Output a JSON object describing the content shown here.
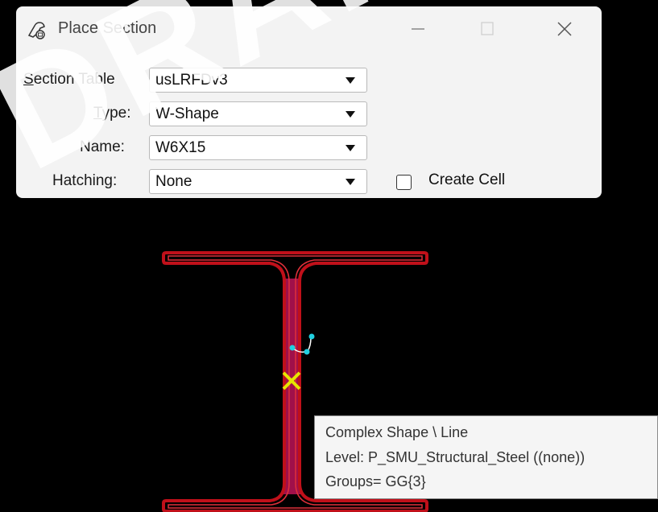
{
  "dialog": {
    "title": "Place Section",
    "labels": {
      "section_table_first": "S",
      "section_table_rest": "ection Table",
      "type_first": "T",
      "type_rest": "ype:",
      "name": "Name:",
      "hatching": "Hatching:"
    },
    "section_table": "usLRFDv3",
    "type": "W-Shape",
    "name": "W6X15",
    "hatching": "None",
    "create_cell_label": "Create Cell",
    "create_cell_checked": false
  },
  "watermark": "DRAFT",
  "tooltip": {
    "line1": "Complex Shape \\ Line",
    "line2": "Level: P_SMU_Structural_Steel ((none))",
    "line3": "Groups= GG{3}"
  },
  "colors": {
    "section_outline": "#c0101a",
    "web_fill": "#a0104a",
    "snap_marker": "#e6e600",
    "handle": "#20d0e0"
  }
}
